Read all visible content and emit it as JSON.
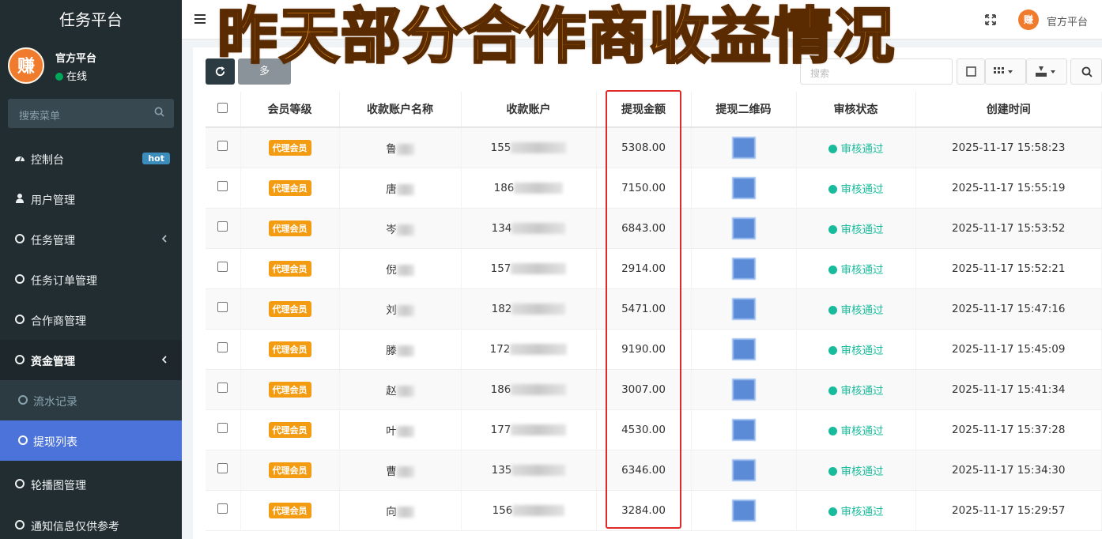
{
  "overlay": {
    "title": "昨天部分合作商收益情况"
  },
  "sidebar": {
    "brand": "任务平台",
    "user": {
      "avatar_text": "赚",
      "name": "官方平台",
      "status": "在线"
    },
    "search_placeholder": "搜索菜单",
    "items": [
      {
        "label": "控制台",
        "badge": "hot"
      },
      {
        "label": "用户管理"
      },
      {
        "label": "任务管理"
      },
      {
        "label": "任务订单管理"
      },
      {
        "label": "合作商管理"
      },
      {
        "label": "资金管理"
      },
      {
        "label": "流水记录"
      },
      {
        "label": "提现列表"
      },
      {
        "label": "轮播图管理"
      },
      {
        "label": "通知信息仅供参考"
      }
    ]
  },
  "header": {
    "user_name": "官方平台",
    "avatar_text": "赚"
  },
  "toolbar": {
    "more_label": "多",
    "search_placeholder": "搜索"
  },
  "table": {
    "columns": [
      "会员等级",
      "收款账户名称",
      "收款账户",
      "提现金额",
      "提现二维码",
      "审核状态",
      "创建时间"
    ],
    "rows": [
      {
        "level": "代理会员",
        "name": "鲁",
        "account": "155",
        "amount": "5308.00",
        "status": "审核通过",
        "time": "2025-11-17 15:58:23"
      },
      {
        "level": "代理会员",
        "name": "唐",
        "account": "186",
        "amount": "7150.00",
        "status": "审核通过",
        "time": "2025-11-17 15:55:19"
      },
      {
        "level": "代理会员",
        "name": "岑",
        "account": "134",
        "amount": "6843.00",
        "status": "审核通过",
        "time": "2025-11-17 15:53:52"
      },
      {
        "level": "代理会员",
        "name": "倪",
        "account": "157",
        "amount": "2914.00",
        "status": "审核通过",
        "time": "2025-11-17 15:52:21"
      },
      {
        "level": "代理会员",
        "name": "刘",
        "account": "182",
        "amount": "5471.00",
        "status": "审核通过",
        "time": "2025-11-17 15:47:16"
      },
      {
        "level": "代理会员",
        "name": "滕",
        "account": "172",
        "amount": "9190.00",
        "status": "审核通过",
        "time": "2025-11-17 15:45:09"
      },
      {
        "level": "代理会员",
        "name": "赵",
        "account": "186",
        "amount": "3007.00",
        "status": "审核通过",
        "time": "2025-11-17 15:41:34"
      },
      {
        "level": "代理会员",
        "name": "叶",
        "account": "177",
        "amount": "4530.00",
        "status": "审核通过",
        "time": "2025-11-17 15:37:28"
      },
      {
        "level": "代理会员",
        "name": "曹",
        "account": "135",
        "amount": "6346.00",
        "status": "审核通过",
        "time": "2025-11-17 15:34:30"
      },
      {
        "level": "代理会员",
        "name": "向",
        "account": "156",
        "amount": "3284.00",
        "status": "审核通过",
        "time": "2025-11-17 15:29:57"
      }
    ]
  }
}
